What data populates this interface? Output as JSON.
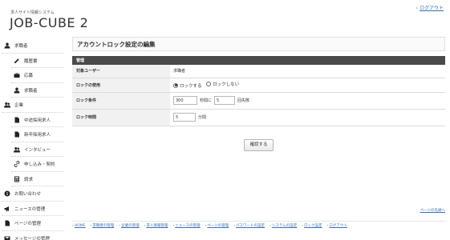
{
  "header": {
    "subtitle": "求人サイト情報システム",
    "logo": "JOB-CUBE 2",
    "logout": "ログアウト"
  },
  "sidebar": {
    "items": [
      {
        "label": "求職者",
        "icon": "user-icon",
        "level": 1
      },
      {
        "label": "履歴書",
        "icon": "pencil-icon",
        "level": 2
      },
      {
        "label": "応募",
        "icon": "briefcase-icon",
        "level": 2
      },
      {
        "label": "求職者",
        "icon": "user-icon",
        "level": 2
      },
      {
        "label": "企業",
        "icon": "users-icon",
        "level": 1
      },
      {
        "label": "中途採用求人",
        "icon": "document-icon",
        "level": 2
      },
      {
        "label": "新卒採用求人",
        "icon": "document-icon",
        "level": 2
      },
      {
        "label": "インタビュー",
        "icon": "users-icon",
        "level": 2
      },
      {
        "label": "申し込み・契約",
        "icon": "link-icon",
        "level": 2
      },
      {
        "label": "請求",
        "icon": "calculator-icon",
        "level": 2
      },
      {
        "label": "お問い合わせ",
        "icon": "info-icon",
        "level": 1
      },
      {
        "label": "ニュースの管理",
        "icon": "megaphone-icon",
        "level": 1
      },
      {
        "label": "ページの管理",
        "icon": "document-icon",
        "level": 1
      },
      {
        "label": "メッセージの管理",
        "icon": "mail-icon",
        "level": 1
      }
    ]
  },
  "main": {
    "title": "アカウントロック設定の編集",
    "section": "管理",
    "rows": {
      "user_label": "対象ユーザー",
      "user_value": "求職者",
      "use_label": "ロックの使用",
      "use_on": "ロックする",
      "use_off": "ロックしない",
      "cond_label": "ロック条件",
      "cond_seconds": "300",
      "cond_seconds_unit": "秒間に",
      "cond_count": "5",
      "cond_count_unit": "回失敗",
      "time_label": "ロック時間",
      "time_value": "5",
      "time_unit": "分間"
    },
    "confirm_button": "確認する"
  },
  "pagetop": "ページの先頭へ",
  "footer": {
    "links": [
      "HOME",
      "求職者の管理",
      "企業の管理",
      "求人情報管理",
      "ニュースの管理",
      "ページの管理",
      "パスワードの設定",
      "システムの設定",
      "ロック設定",
      "ログアウト"
    ]
  }
}
